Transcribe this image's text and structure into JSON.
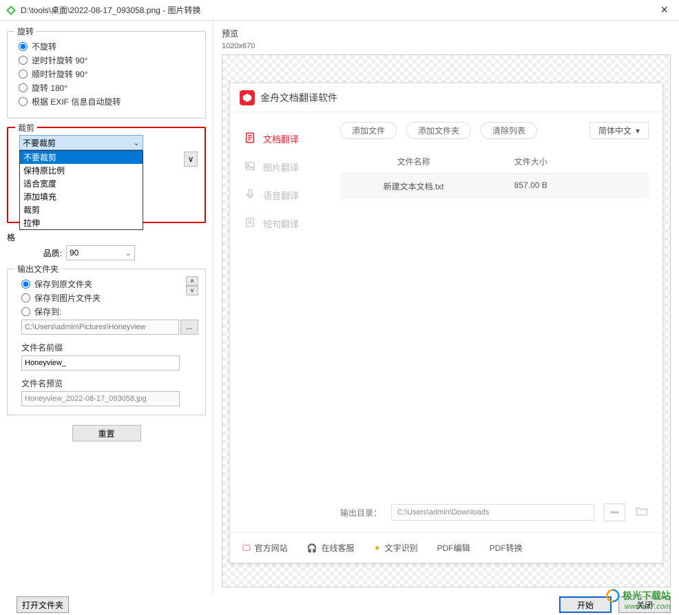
{
  "titlebar": {
    "title": "D:\\tools\\桌面\\2022-08-17_093058.png - 图片转换"
  },
  "rotate": {
    "legend": "旋转",
    "opts": [
      "不旋转",
      "逆时针旋转 90°",
      "顺时针旋转 90°",
      "旋转 180°",
      "根据 EXIF 信息自动旋转"
    ],
    "selected": 0
  },
  "crop": {
    "legend": "裁剪",
    "selected": "不要裁剪",
    "options": [
      "不要裁剪",
      "保持原比例",
      "适合宽度",
      "添加填充",
      "裁剪",
      "拉伸"
    ]
  },
  "format": {
    "legend": "格",
    "quality_label": "品质:",
    "quality_value": "90"
  },
  "output": {
    "legend": "输出文件夹",
    "opts": [
      "保存到原文件夹",
      "保存到图片文件夹",
      "保存到:"
    ],
    "selected": 0,
    "path": "C:\\Users\\admin\\Pictures\\Honeyview",
    "prefix_label": "文件名前缀",
    "prefix_value": "Honeyview_",
    "preview_label": "文件名预览",
    "preview_value": "Honeyview_2022-08-17_093058.jpg"
  },
  "reset_label": "重置",
  "preview": {
    "label": "预览",
    "dims": "1020x670"
  },
  "inner_app": {
    "title": "金舟文档翻译软件",
    "side": [
      "文档翻译",
      "图片翻译",
      "语音翻译",
      "短句翻译"
    ],
    "btns": [
      "添加文件",
      "添加文件夹",
      "清除列表"
    ],
    "lang": "简体中文",
    "tbl_head": [
      "文件名称",
      "文件大小",
      ""
    ],
    "row": [
      "新建文本文档.txt",
      "857.00 B",
      ""
    ],
    "out_label": "输出目录：",
    "out_path": "C:\\Users\\admin\\Downloads",
    "foot": [
      "官方网站",
      "在线客服",
      "文字识别",
      "PDF编辑",
      "PDF转换"
    ]
  },
  "bottom": {
    "open_folder": "打开文件夹",
    "start": "开始",
    "close": "关闭"
  },
  "watermark": {
    "line1": "极光下载站",
    "line2": "www.xz7.com"
  }
}
